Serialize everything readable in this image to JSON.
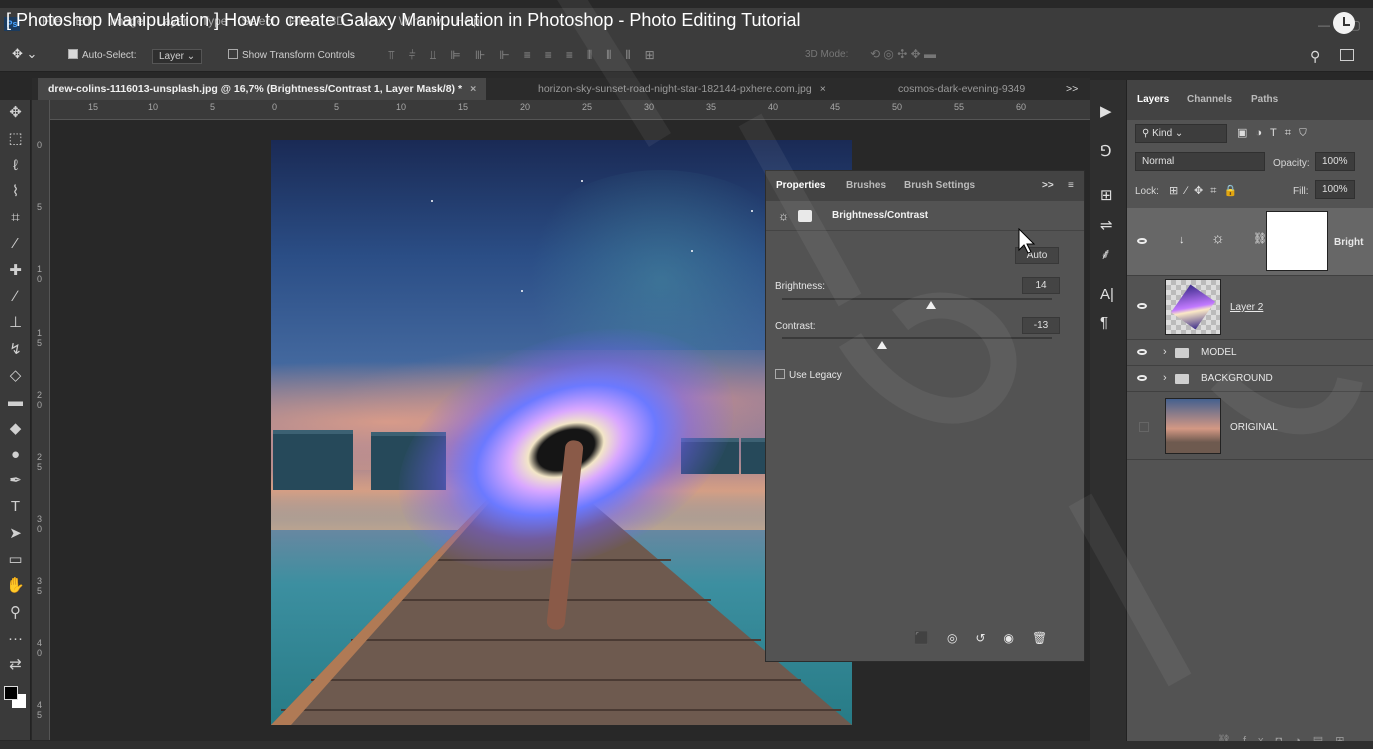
{
  "video_title": "[ Photoshop Manipulation ] How to create Galaxy Manipulation in Photoshop - Photo Editing Tutorial",
  "menu": [
    "File",
    "Edit",
    "Image",
    "Layer",
    "Type",
    "Select",
    "Filter",
    "3D",
    "View",
    "Window",
    "Help"
  ],
  "options_bar": {
    "auto_select_label": "Auto-Select:",
    "auto_select_target": "Layer",
    "transform_label": "Show Transform Controls",
    "mode_3d": "3D Mode:"
  },
  "tabs": [
    {
      "label": "drew-colins-1116013-unsplash.jpg @ 16,7% (Brightness/Contrast 1, Layer Mask/8) *"
    },
    {
      "label": "horizon-sky-sunset-road-night-star-182144-pxhere.com.jpg"
    },
    {
      "label": "cosmos-dark-evening-9349"
    }
  ],
  "tab_overflow": ">>",
  "ruler_h": [
    "15",
    "10",
    "5",
    "0",
    "5",
    "10",
    "15",
    "20",
    "25",
    "30",
    "35",
    "40",
    "45",
    "50",
    "55",
    "60"
  ],
  "ruler_v": [
    "0",
    "5",
    "1",
    "0",
    "1",
    "5",
    "2",
    "0",
    "2",
    "5",
    "3",
    "0",
    "3",
    "5",
    "4",
    "0",
    "4",
    "5"
  ],
  "properties": {
    "tabs": [
      "Properties",
      "Brushes",
      "Brush Settings"
    ],
    "tab_overflow": ">>",
    "adjustment_title": "Brightness/Contrast",
    "auto_button": "Auto",
    "brightness_label": "Brightness:",
    "brightness_value": "14",
    "brightness_fraction": 0.55,
    "contrast_label": "Contrast:",
    "contrast_value": "-13",
    "contrast_fraction": 0.37,
    "use_legacy_label": "Use Legacy"
  },
  "layers_panel": {
    "tabs": [
      "Layers",
      "Channels",
      "Paths"
    ],
    "filter_kind": "Kind",
    "blend_mode": "Normal",
    "opacity_label": "Opacity:",
    "opacity_value": "100%",
    "lock_label": "Lock:",
    "fill_label": "Fill:",
    "fill_value": "100%",
    "layers": [
      {
        "name": "Bright",
        "type": "adjustment"
      },
      {
        "name": "Layer 2",
        "type": "pixel"
      },
      {
        "name": "MODEL",
        "type": "group"
      },
      {
        "name": "BACKGROUND",
        "type": "group"
      },
      {
        "name": "ORIGINAL",
        "type": "pixel"
      }
    ]
  },
  "colors": {
    "app_bg": "#282828",
    "panel_bg": "#535353",
    "active_tab": "#474747"
  }
}
